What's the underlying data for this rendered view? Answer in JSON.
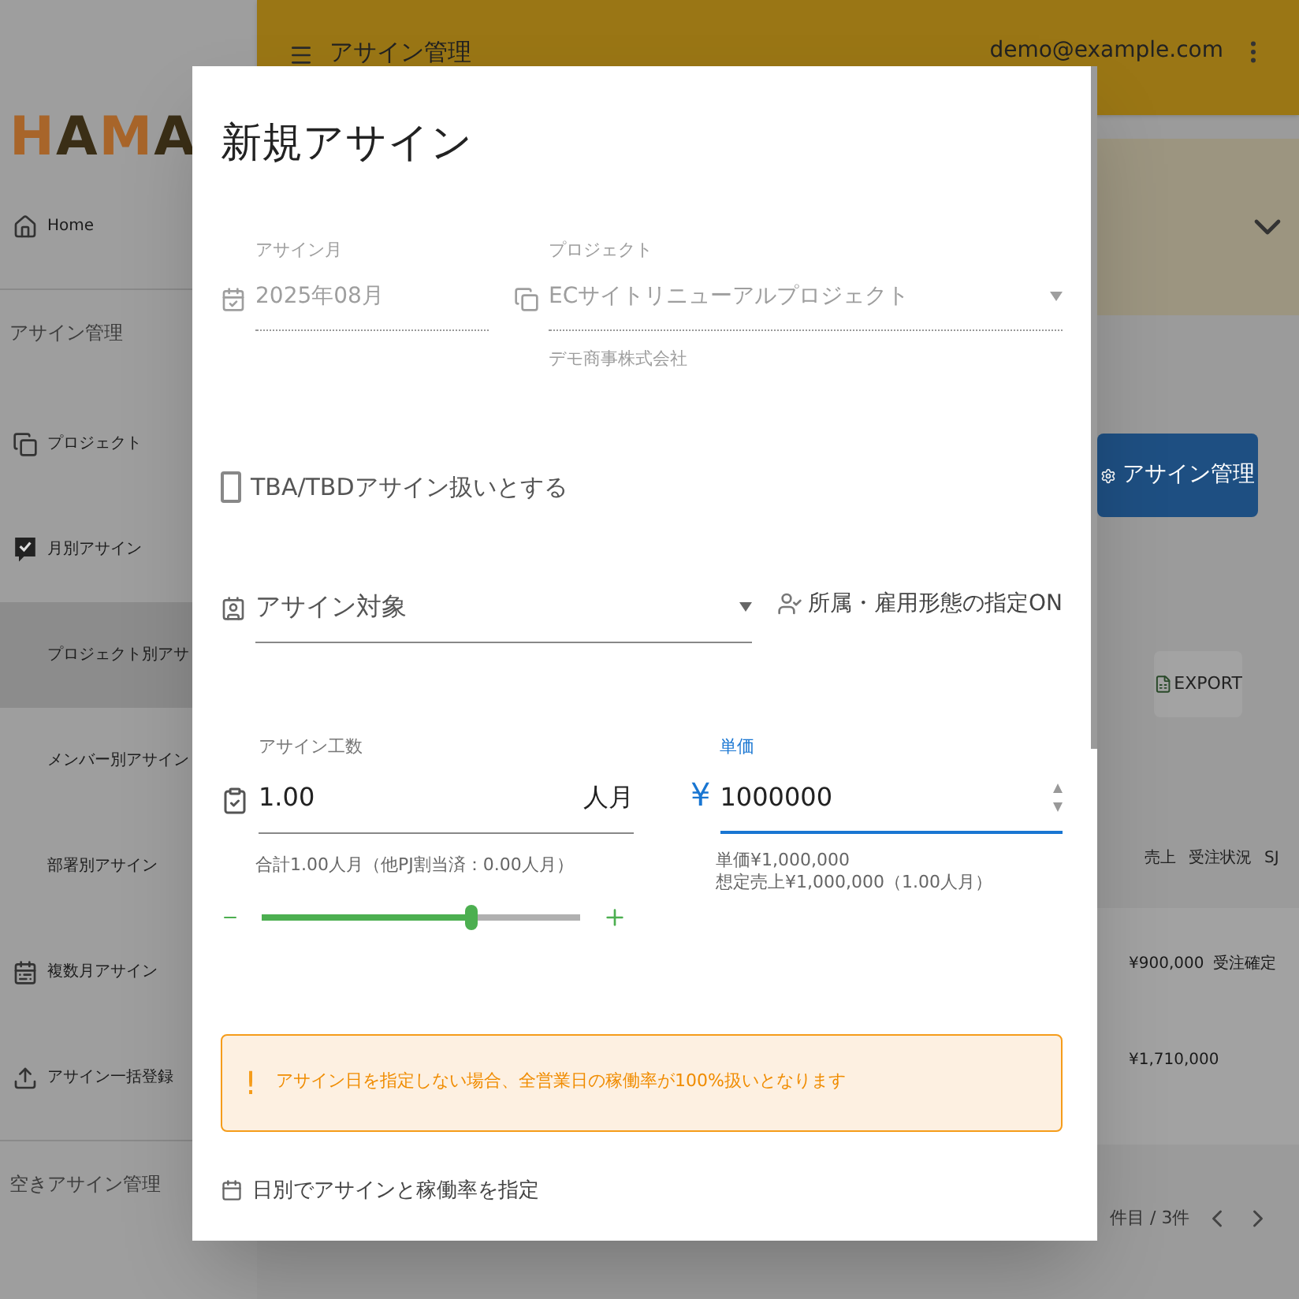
{
  "logo": "HAMA",
  "header": {
    "title": "アサイン管理",
    "user": "demo@example.com"
  },
  "sidebar": {
    "items": [
      {
        "kind": "link",
        "label": "Home",
        "selected": false
      },
      {
        "kind": "section",
        "label": "アサイン管理"
      },
      {
        "kind": "link",
        "label": "プロジェクト",
        "selected": false
      },
      {
        "kind": "link",
        "label": "月別アサイン",
        "selected": false
      },
      {
        "kind": "link",
        "label": "プロジェクト別アサ",
        "selected": true
      },
      {
        "kind": "link",
        "label": "メンバー別アサイン",
        "selected": false
      },
      {
        "kind": "link",
        "label": "部署別アサイン",
        "selected": false
      },
      {
        "kind": "link",
        "label": "複数月アサイン",
        "selected": false
      },
      {
        "kind": "link",
        "label": "アサイン一括登録",
        "selected": false
      },
      {
        "kind": "section",
        "label": "空きアサイン管理"
      }
    ]
  },
  "main": {
    "manage_button": "アサイン管理",
    "export_button": "EXPORT",
    "table": {
      "columns": [
        "売上",
        "受注状況",
        "SJ"
      ],
      "rows": [
        [
          "¥900,000",
          "受注確定"
        ],
        [
          "¥1,710,000"
        ]
      ]
    },
    "pagination": "件目 / 3件"
  },
  "dialog": {
    "title": "新規アサイン",
    "month": {
      "label": "アサイン月",
      "value": "2025年08月"
    },
    "project": {
      "label": "プロジェクト",
      "value": "ECサイトリニューアルプロジェクト",
      "helper": "デモ商事株式会社"
    },
    "tba": {
      "label": "TBA/TBDアサイン扱いとする",
      "checked": false
    },
    "target": {
      "placeholder": "アサイン対象"
    },
    "filter": {
      "label": "所属・雇用形態の指定ON"
    },
    "effort": {
      "label": "アサイン工数",
      "value": "1.00",
      "unit": "人月",
      "helper": "合計1.00人月（他PJ割当済：0.00人月）",
      "level": 0.66
    },
    "price": {
      "label": "単価",
      "currency": "¥",
      "value": "1000000",
      "helper_lines": [
        "単価¥1,000,000",
        "想定売上¥1,000,000（1.00人月）"
      ]
    },
    "alert": {
      "mark": "!",
      "text": "アサイン日を指定しない場合、全営業日の稼働率が100%扱いとなります"
    },
    "daily": {
      "label": "日別でアサインと稼働率を指定"
    }
  }
}
